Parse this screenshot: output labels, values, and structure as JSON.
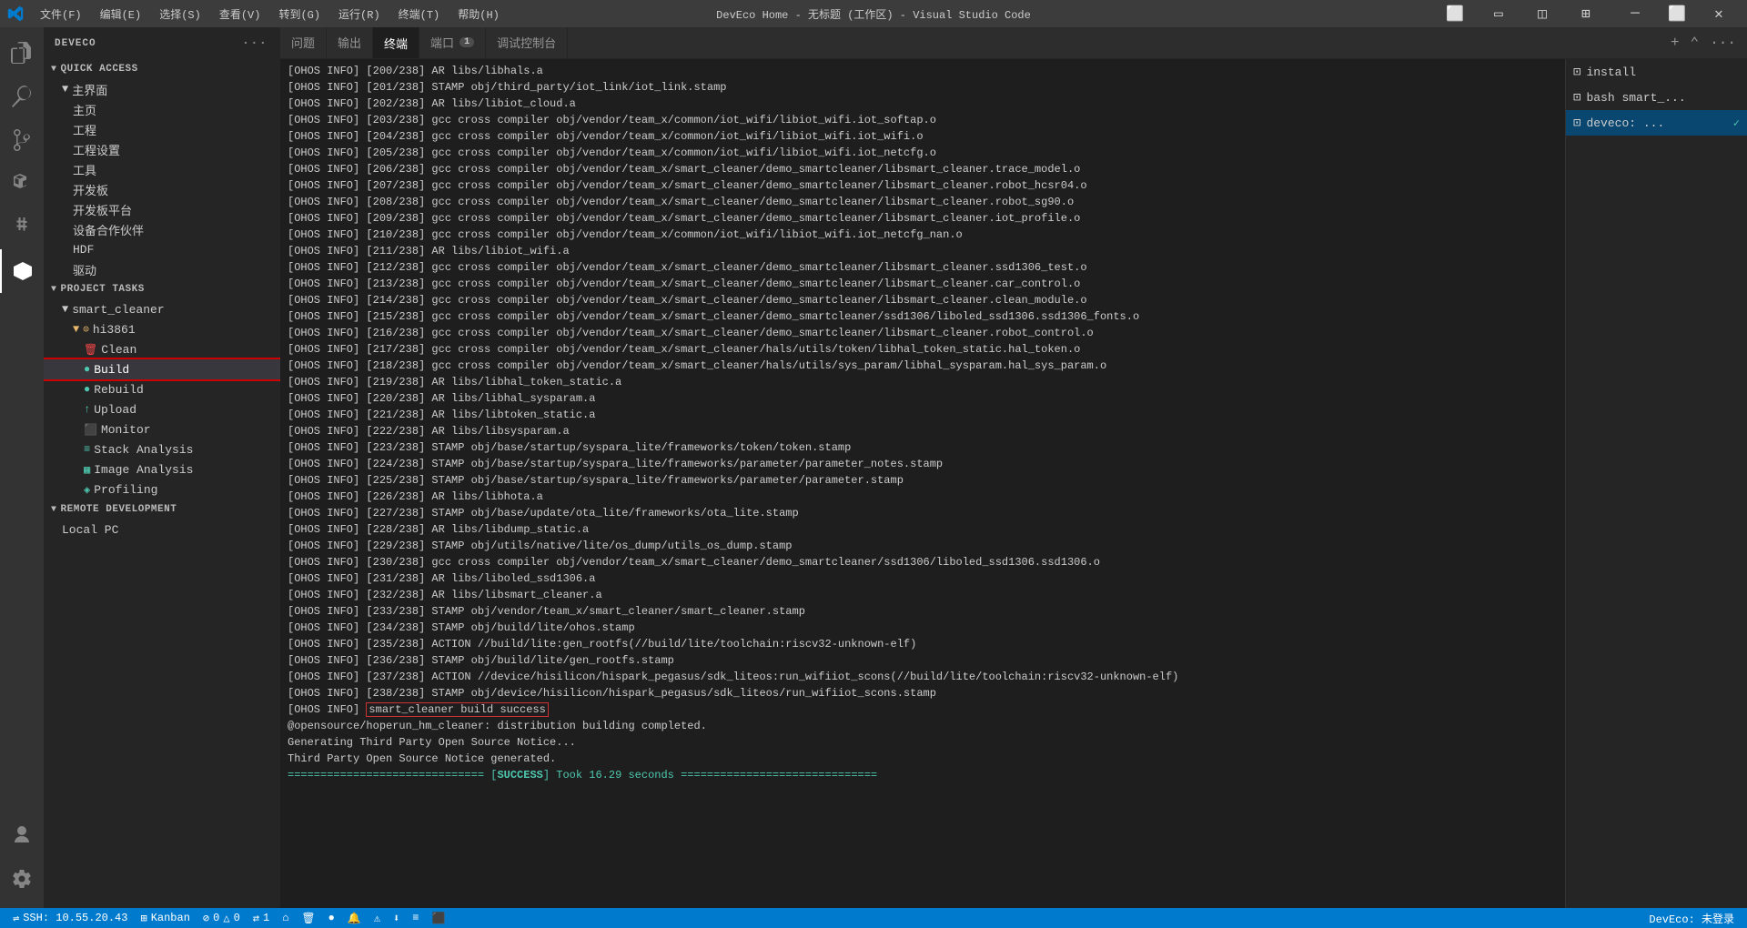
{
  "titlebar": {
    "title": "DevEco Home - 无标题 (工作区) - Visual Studio Code",
    "menus": [
      "文件(F)",
      "编辑(E)",
      "选择(S)",
      "查看(V)",
      "转到(G)",
      "运行(R)",
      "终端(T)",
      "帮助(H)"
    ]
  },
  "sidebar": {
    "header": "DEVECO",
    "sections": {
      "quick_access": {
        "title": "QUICK ACCESS",
        "items": [
          {
            "label": "主界面",
            "indent": 2,
            "type": "folder"
          },
          {
            "label": "主页",
            "indent": 3,
            "type": "item"
          },
          {
            "label": "工程",
            "indent": 3,
            "type": "item"
          },
          {
            "label": "工程设置",
            "indent": 3,
            "type": "item"
          },
          {
            "label": "工具",
            "indent": 3,
            "type": "item"
          },
          {
            "label": "开发板",
            "indent": 3,
            "type": "item"
          },
          {
            "label": "开发板平台",
            "indent": 3,
            "type": "item"
          },
          {
            "label": "设备合作伙伴",
            "indent": 3,
            "type": "item"
          },
          {
            "label": "HDF",
            "indent": 3,
            "type": "item"
          },
          {
            "label": "驱动",
            "indent": 3,
            "type": "item"
          }
        ]
      },
      "project_tasks": {
        "title": "PROJECT TASKS",
        "items": [
          {
            "label": "smart_cleaner",
            "indent": 2,
            "type": "folder"
          },
          {
            "label": "hi3861",
            "indent": 3,
            "type": "folder",
            "icon": "location"
          },
          {
            "label": "Clean",
            "indent": 4,
            "type": "clean"
          },
          {
            "label": "Build",
            "indent": 4,
            "type": "build",
            "selected": true
          },
          {
            "label": "Rebuild",
            "indent": 4,
            "type": "rebuild"
          },
          {
            "label": "Upload",
            "indent": 4,
            "type": "upload"
          },
          {
            "label": "Monitor",
            "indent": 4,
            "type": "monitor"
          },
          {
            "label": "Stack Analysis",
            "indent": 4,
            "type": "stack"
          },
          {
            "label": "Image Analysis",
            "indent": 4,
            "type": "image"
          },
          {
            "label": "Profiling",
            "indent": 4,
            "type": "profiling"
          }
        ]
      },
      "remote_dev": {
        "title": "REMOTE DEVELOPMENT",
        "items": [
          {
            "label": "Local PC",
            "indent": 2
          }
        ]
      }
    }
  },
  "tabs": [
    {
      "label": "问题",
      "active": false
    },
    {
      "label": "输出",
      "active": false
    },
    {
      "label": "终端",
      "active": true
    },
    {
      "label": "端口",
      "active": false,
      "badge": "1"
    },
    {
      "label": "调试控制台",
      "active": false
    }
  ],
  "terminal": {
    "lines": [
      "[OHOS INFO] [200/238] AR libs/libhals.a",
      "[OHOS INFO] [201/238] STAMP obj/third_party/iot_link/iot_link.stamp",
      "[OHOS INFO] [202/238] AR libs/libiot_cloud.a",
      "[OHOS INFO] [203/238] gcc cross compiler obj/vendor/team_x/common/iot_wifi/libiot_wifi.iot_softap.o",
      "[OHOS INFO] [204/238] gcc cross compiler obj/vendor/team_x/common/iot_wifi/libiot_wifi.iot_wifi.o",
      "[OHOS INFO] [205/238] gcc cross compiler obj/vendor/team_x/common/iot_wifi/libiot_wifi.iot_netcfg.o",
      "[OHOS INFO] [206/238] gcc cross compiler obj/vendor/team_x/smart_cleaner/demo_smartcleaner/libsmart_cleaner.trace_model.o",
      "[OHOS INFO] [207/238] gcc cross compiler obj/vendor/team_x/smart_cleaner/demo_smartcleaner/libsmart_cleaner.robot_hcsr04.o",
      "[OHOS INFO] [208/238] gcc cross compiler obj/vendor/team_x/smart_cleaner/demo_smartcleaner/libsmart_cleaner.robot_sg90.o",
      "[OHOS INFO] [209/238] gcc cross compiler obj/vendor/team_x/smart_cleaner/demo_smartcleaner/libsmart_cleaner.iot_profile.o",
      "[OHOS INFO] [210/238] gcc cross compiler obj/vendor/team_x/common/iot_wifi/libiot_wifi.iot_netcfg_nan.o",
      "[OHOS INFO] [211/238] AR libs/libiot_wifi.a",
      "[OHOS INFO] [212/238] gcc cross compiler obj/vendor/team_x/smart_cleaner/demo_smartcleaner/libsmart_cleaner.ssd1306_test.o",
      "[OHOS INFO] [213/238] gcc cross compiler obj/vendor/team_x/smart_cleaner/demo_smartcleaner/libsmart_cleaner.car_control.o",
      "[OHOS INFO] [214/238] gcc cross compiler obj/vendor/team_x/smart_cleaner/demo_smartcleaner/libsmart_cleaner.clean_module.o",
      "[OHOS INFO] [215/238] gcc cross compiler obj/vendor/team_x/smart_cleaner/demo_smartcleaner/ssd1306/liboled_ssd1306.ssd1306_fonts.o",
      "[OHOS INFO] [216/238] gcc cross compiler obj/vendor/team_x/smart_cleaner/demo_smartcleaner/libsmart_cleaner.robot_control.o",
      "[OHOS INFO] [217/238] gcc cross compiler obj/vendor/team_x/smart_cleaner/hals/utils/token/libhal_token_static.hal_token.o",
      "[OHOS INFO] [218/238] gcc cross compiler obj/vendor/team_x/smart_cleaner/hals/utils/sys_param/libhal_sysparam.hal_sys_param.o",
      "[OHOS INFO] [219/238] AR libs/libhal_token_static.a",
      "[OHOS INFO] [220/238] AR libs/libhal_sysparam.a",
      "[OHOS INFO] [221/238] AR libs/libtoken_static.a",
      "[OHOS INFO] [222/238] AR libs/libsysparam.a",
      "[OHOS INFO] [223/238] STAMP obj/base/startup/syspara_lite/frameworks/token/token.stamp",
      "[OHOS INFO] [224/238] STAMP obj/base/startup/syspara_lite/frameworks/parameter/parameter_notes.stamp",
      "[OHOS INFO] [225/238] STAMP obj/base/startup/syspara_lite/frameworks/parameter/parameter.stamp",
      "[OHOS INFO] [226/238] AR libs/libhota.a",
      "[OHOS INFO] [227/238] STAMP obj/base/update/ota_lite/frameworks/ota_lite.stamp",
      "[OHOS INFO] [228/238] AR libs/libdump_static.a",
      "[OHOS INFO] [229/238] STAMP obj/utils/native/lite/os_dump/utils_os_dump.stamp",
      "[OHOS INFO] [230/238] gcc cross compiler obj/vendor/team_x/smart_cleaner/demo_smartcleaner/ssd1306/liboled_ssd1306.ssd1306.o",
      "[OHOS INFO] [231/238] AR libs/liboled_ssd1306.a",
      "[OHOS INFO] [232/238] AR libs/libsmart_cleaner.a",
      "[OHOS INFO] [233/238] STAMP obj/vendor/team_x/smart_cleaner/smart_cleaner.stamp",
      "[OHOS INFO] [234/238] STAMP obj/build/lite/ohos.stamp",
      "[OHOS INFO] [235/238] ACTION //build/lite:gen_rootfs(//build/lite/toolchain:riscv32-unknown-elf)",
      "[OHOS INFO] [236/238] STAMP obj/build/lite/gen_rootfs.stamp",
      "[OHOS INFO] [237/238] ACTION //device/hisilicon/hispark_pegasus/sdk_liteos:run_wifiiot_scons(//build/lite/toolchain:riscv32-unknown-elf)",
      "[OHOS INFO] [238/238] STAMP obj/device/hisilicon/hispark_pegasus/sdk_liteos/run_wifiiot_scons.stamp",
      "HIGHLIGHT:smart_cleaner build success",
      "@opensource/hoperun_hm_cleaner: distribution building completed.",
      "Generating Third Party Open Source Notice...",
      "Third Party Open Source Notice generated.",
      "SUCCESS_BANNER:============================== [SUCCESS] Took 16.29 seconds =============================="
    ]
  },
  "right_panel": {
    "items": [
      {
        "label": "install",
        "icon": "term"
      },
      {
        "label": "bash smart_...",
        "icon": "term"
      },
      {
        "label": "deveco: ...",
        "icon": "term",
        "active": true
      }
    ]
  },
  "status_bar": {
    "left": [
      {
        "icon": "ssh",
        "label": "SSH: 10.55.20.43"
      },
      {
        "icon": "kanban",
        "label": "Kanban"
      },
      {
        "icon": "error",
        "label": "⊘ 0"
      },
      {
        "icon": "warning",
        "label": "△ 0"
      },
      {
        "icon": "sync",
        "label": "⇄ 1"
      },
      {
        "icon": "home",
        "label": "⌂"
      },
      {
        "icon": "trash",
        "label": "🗑"
      },
      {
        "icon": "circle",
        "label": "●"
      },
      {
        "icon": "bell",
        "label": "🔔"
      },
      {
        "icon": "warning2",
        "label": "⚠"
      },
      {
        "icon": "plug",
        "label": "⬇"
      },
      {
        "icon": "list",
        "label": "≡"
      },
      {
        "icon": "code",
        "label": "⬛"
      }
    ],
    "right": "DevEco: 未登录"
  }
}
